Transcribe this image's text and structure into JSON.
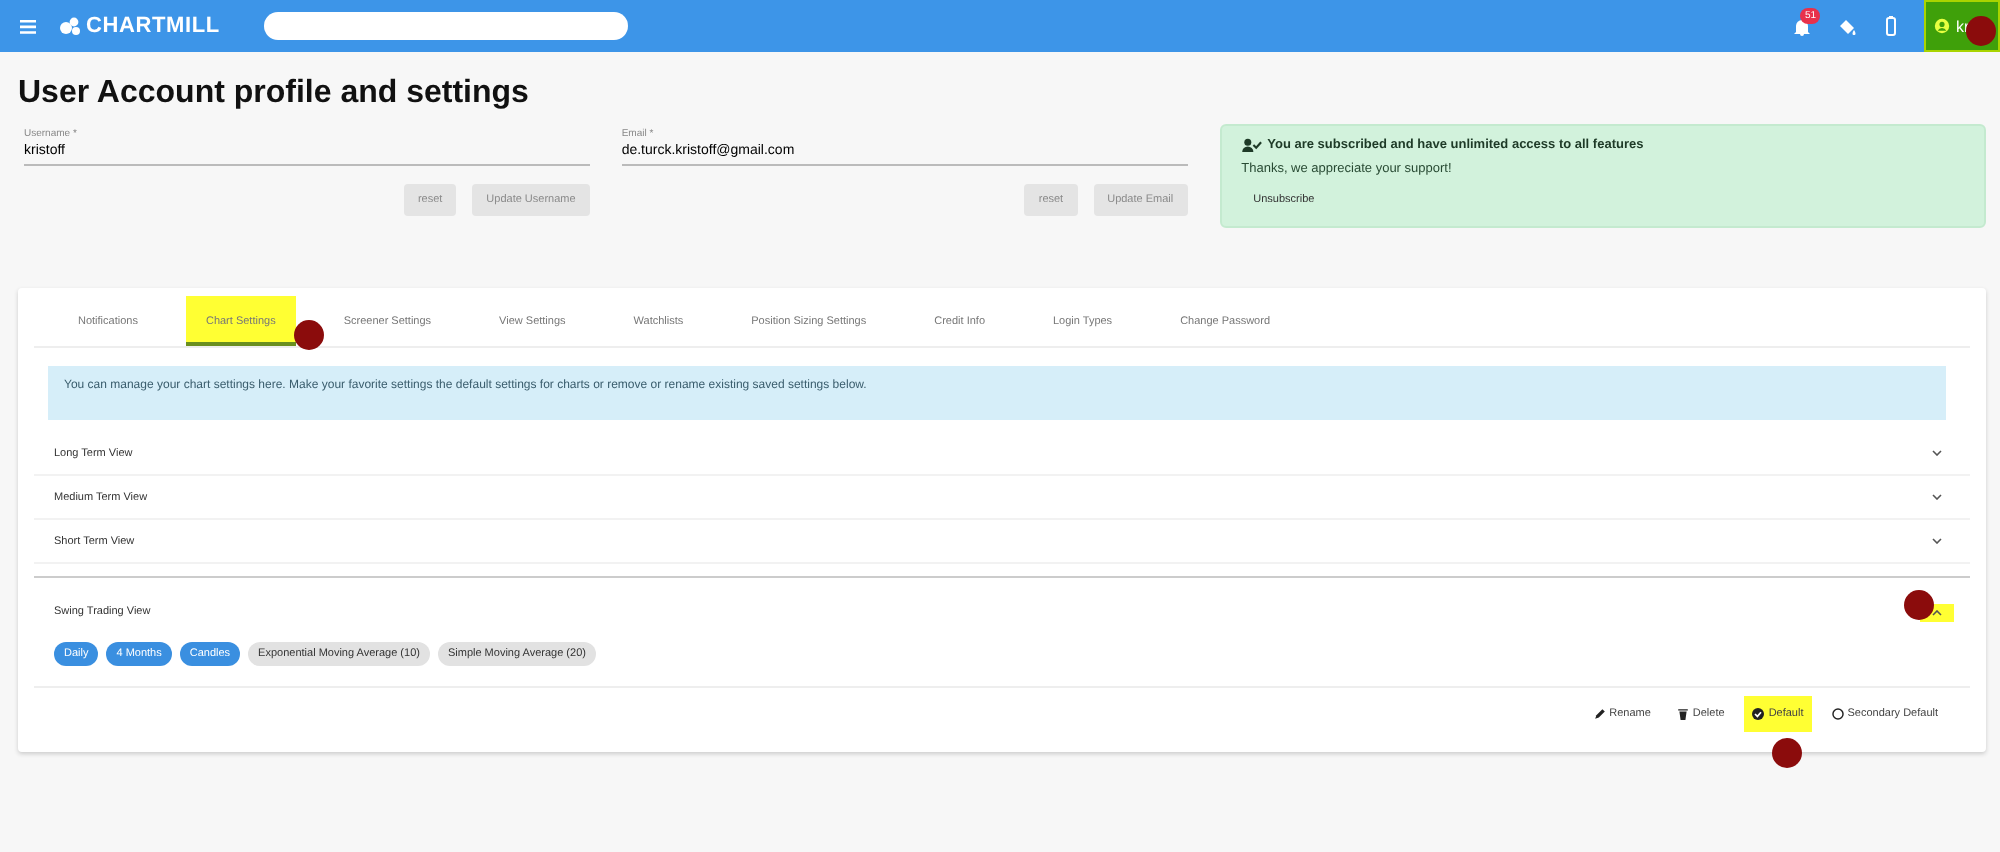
{
  "navbar": {
    "brand": "CHARTMILL",
    "notification_count": "51",
    "user": "kr"
  },
  "title": "User Account profile and settings",
  "username": {
    "label": "Username *",
    "value": "kristoff",
    "buttons": [
      {
        "label": "reset",
        "disabled": true
      },
      {
        "label": "Update Username",
        "disabled": true
      }
    ]
  },
  "email": {
    "label": "Email *",
    "value": "de.turck.kristoff@gmail.com",
    "buttons": [
      {
        "label": "reset",
        "disabled": true
      },
      {
        "label": "Update Email",
        "disabled": true
      }
    ]
  },
  "subscription": {
    "title": "You are subscribed and have unlimited access to all features",
    "text": "Thanks, we appreciate your support!",
    "button": "Unsubscribe"
  },
  "tabs": [
    {
      "label": "Notifications",
      "selected": false,
      "highlighted": false
    },
    {
      "label": "Chart Settings",
      "selected": true,
      "highlighted": true
    },
    {
      "label": "Screener Settings",
      "selected": false,
      "highlighted": false
    },
    {
      "label": "View Settings",
      "selected": false,
      "highlighted": false
    },
    {
      "label": "Watchlists",
      "selected": false,
      "highlighted": false
    },
    {
      "label": "Position Sizing Settings",
      "selected": false,
      "highlighted": false
    },
    {
      "label": "Credit Info",
      "selected": false,
      "highlighted": false
    },
    {
      "label": "Login Types",
      "selected": false,
      "highlighted": false
    },
    {
      "label": "Change Password",
      "selected": false,
      "highlighted": false
    }
  ],
  "info": "You can manage your chart settings here. Make your favorite settings the default settings for charts or remove or rename existing saved settings below.",
  "views": [
    {
      "name": "Long Term View",
      "expanded": false
    },
    {
      "name": "Medium Term View",
      "expanded": false
    },
    {
      "name": "Short Term View",
      "expanded": false
    },
    {
      "name": "Swing Trading View",
      "expanded": true,
      "highlighted": true,
      "chips": [
        {
          "label": "Daily",
          "selected": true
        },
        {
          "label": "4 Months",
          "selected": true
        },
        {
          "label": "Candles",
          "selected": true
        },
        {
          "label": "Exponential Moving Average (10)",
          "selected": false
        },
        {
          "label": "Simple Moving Average (20)",
          "selected": false
        }
      ],
      "actions": [
        {
          "kind": "rename",
          "label": "Rename",
          "highlighted": false
        },
        {
          "kind": "delete",
          "label": "Delete",
          "highlighted": false
        },
        {
          "kind": "default",
          "label": "Default",
          "checked": true,
          "highlighted": true
        },
        {
          "kind": "secondary",
          "label": "Secondary Default",
          "checked": false,
          "highlighted": false
        }
      ]
    }
  ]
}
